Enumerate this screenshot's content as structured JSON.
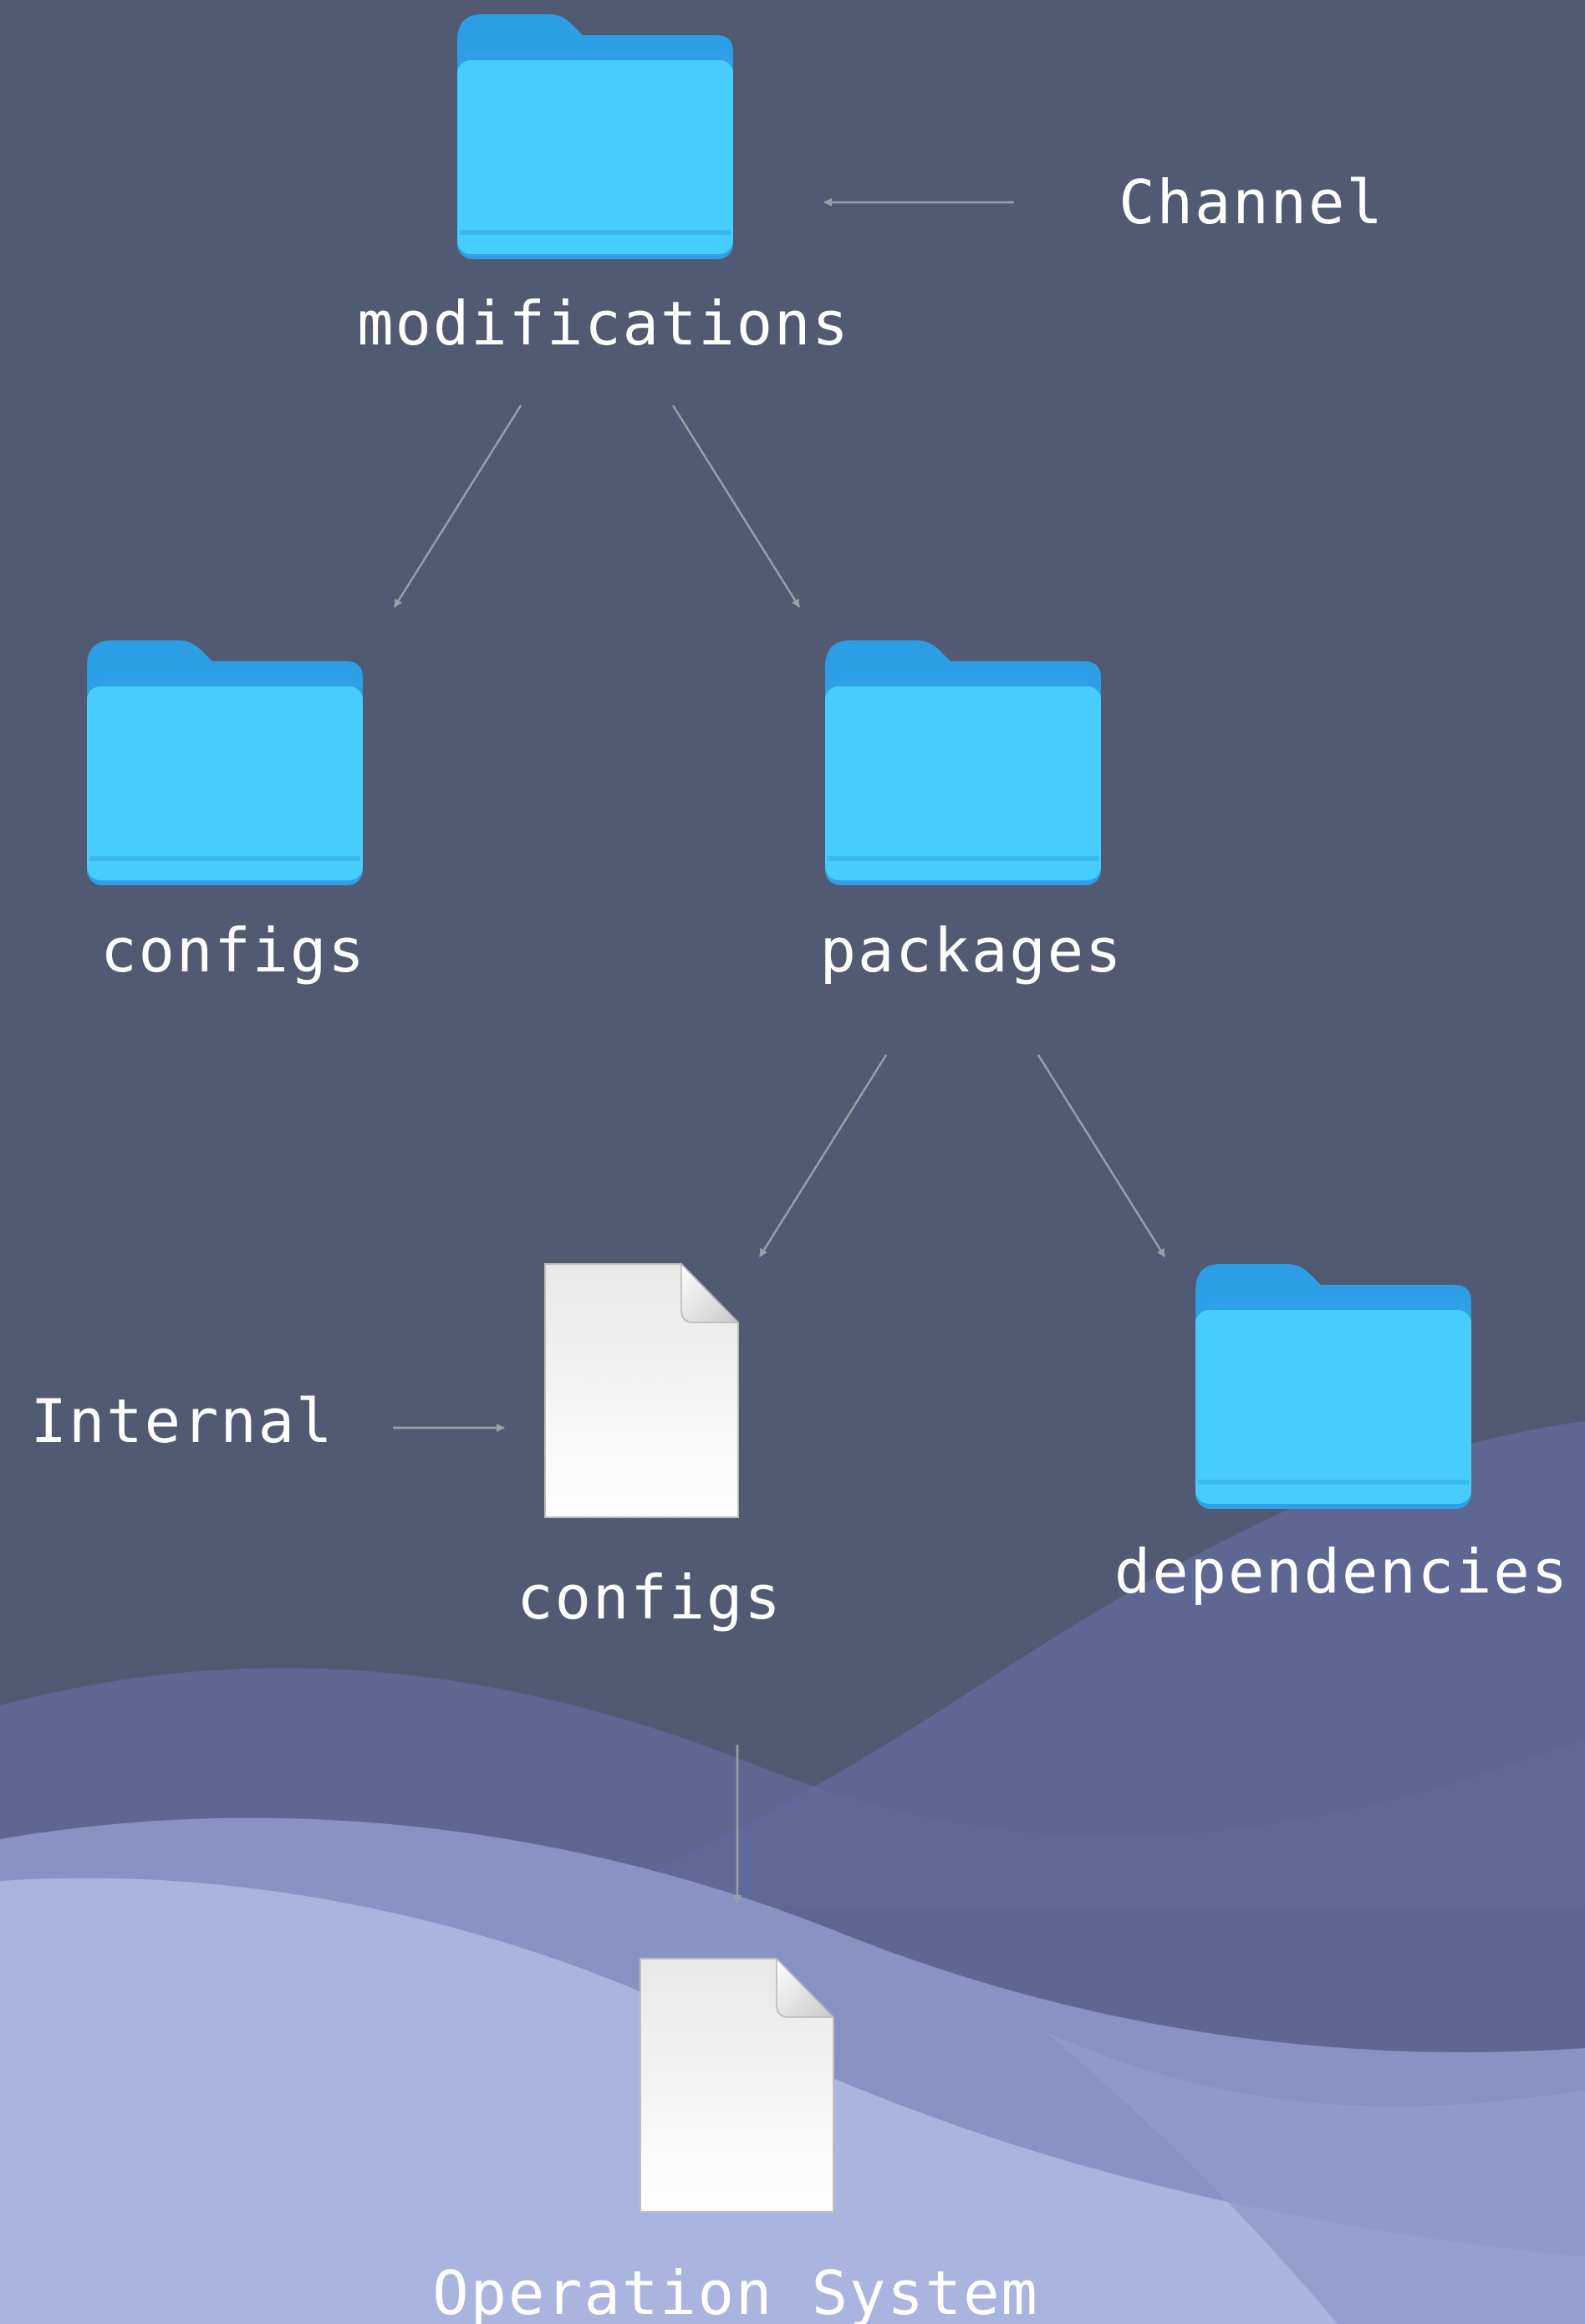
{
  "diagram": {
    "nodes": [
      {
        "id": "modifications",
        "label": "modifications",
        "icon": "folder-icon"
      },
      {
        "id": "configs-folder",
        "label": "configs",
        "icon": "folder-icon"
      },
      {
        "id": "packages",
        "label": "packages",
        "icon": "folder-icon"
      },
      {
        "id": "configs-file",
        "label": "configs",
        "icon": "document-icon"
      },
      {
        "id": "dependencies",
        "label": "dependencies",
        "icon": "folder-icon"
      },
      {
        "id": "operation-system",
        "label": "Operation System",
        "icon": "document-icon"
      }
    ],
    "annotations": [
      {
        "id": "channel",
        "label": "Channel",
        "points_to": "modifications"
      },
      {
        "id": "internal",
        "label": "Internal",
        "points_to": "configs-file"
      }
    ],
    "edges": [
      {
        "from": "modifications",
        "to": "configs-folder"
      },
      {
        "from": "modifications",
        "to": "packages"
      },
      {
        "from": "packages",
        "to": "configs-file"
      },
      {
        "from": "packages",
        "to": "dependencies"
      },
      {
        "from": "configs-file",
        "to": "operation-system"
      }
    ]
  },
  "colors": {
    "background": "#525a73",
    "folder_body": "#46cdfc",
    "folder_tab": "#2c9ee6",
    "document": "#f7f7f7",
    "arrow": "#9c9fa8",
    "label": "#ffffff"
  }
}
